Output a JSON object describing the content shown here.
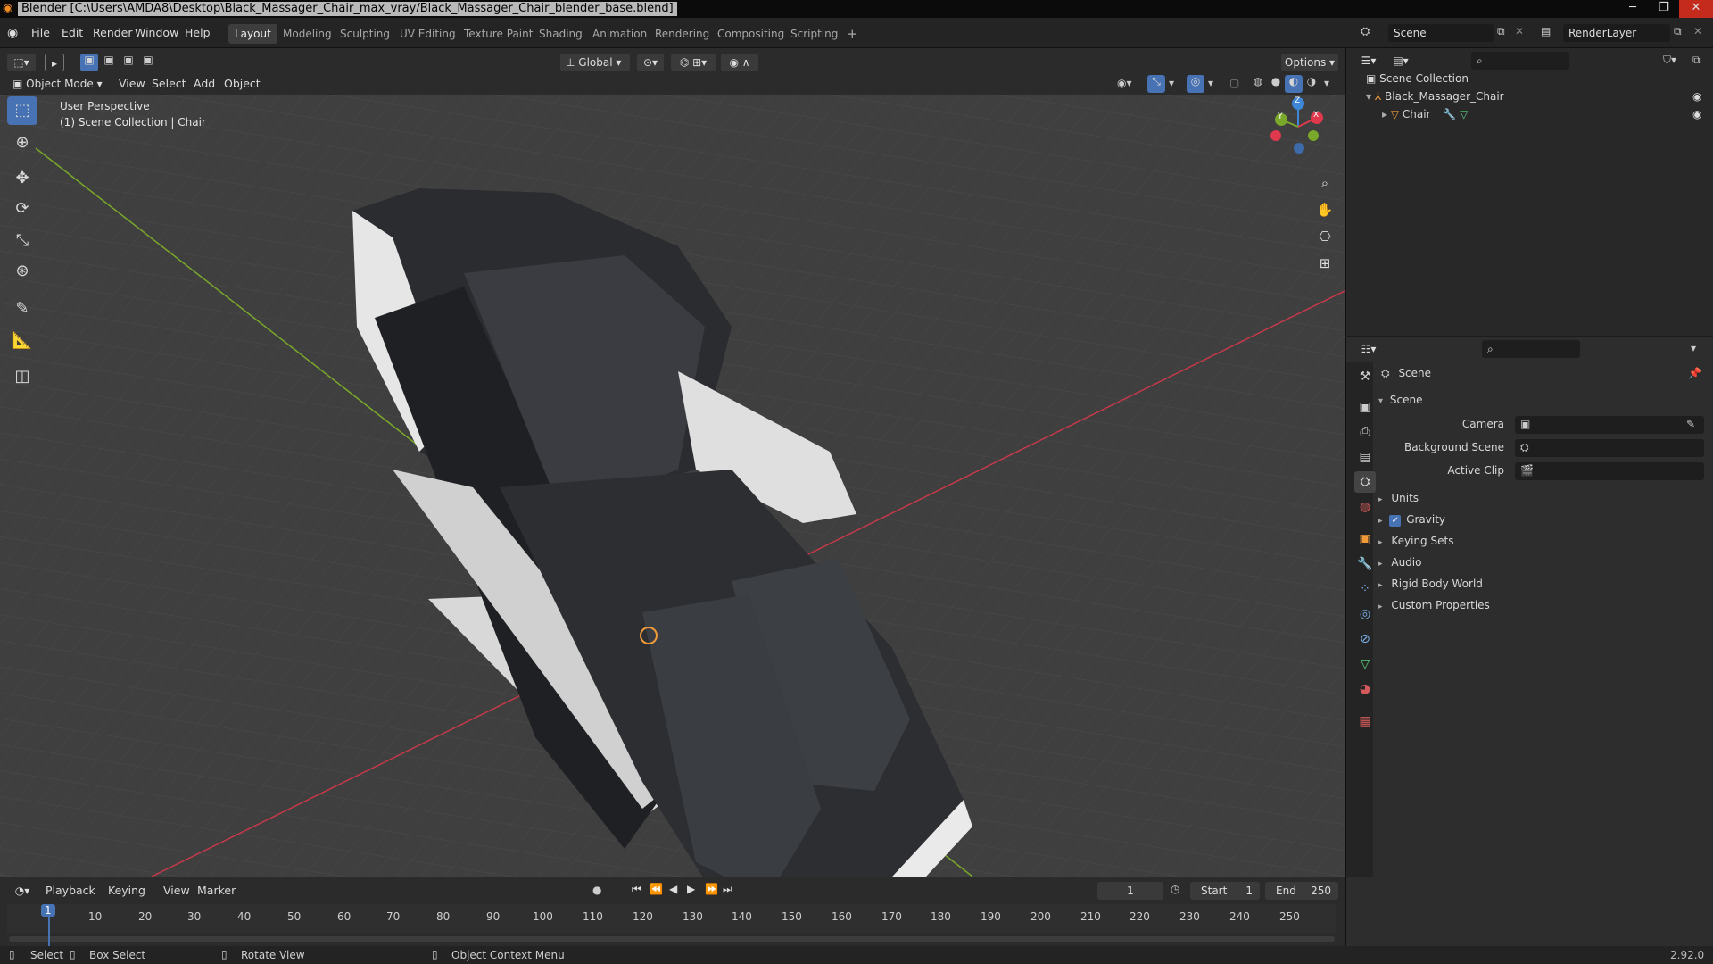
{
  "window": {
    "title": "Blender [C:\\Users\\AMDA8\\Desktop\\Black_Massager_Chair_max_vray/Black_Massager_Chair_blender_base.blend]",
    "controls": [
      "─",
      "❐",
      "✕"
    ]
  },
  "menubar": {
    "menus": [
      "File",
      "Edit",
      "Render",
      "Window",
      "Help"
    ],
    "workspaces": [
      "Layout",
      "Modeling",
      "Sculpting",
      "UV Editing",
      "Texture Paint",
      "Shading",
      "Animation",
      "Rendering",
      "Compositing",
      "Scripting"
    ],
    "active_workspace": "Layout",
    "add_workspace": "+",
    "scene_name": "Scene",
    "view_layer": "RenderLayer"
  },
  "viewport_header": {
    "transform_orientation": "Global",
    "options_label": "Options",
    "mode": "Object Mode",
    "menus": [
      "View",
      "Select",
      "Add",
      "Object"
    ]
  },
  "viewport": {
    "perspective": "User Perspective",
    "collection_info": "(1) Scene Collection | Chair",
    "gizmo_axes": [
      "X",
      "Y",
      "Z"
    ]
  },
  "outliner": {
    "root": "Scene Collection",
    "items": [
      {
        "label": "Black_Massager_Chair",
        "icon": "empty-axes-icon"
      },
      {
        "label": "Chair",
        "icon": "mesh-object-icon"
      }
    ]
  },
  "properties": {
    "context_title": "Scene",
    "panel_title": "Scene",
    "fields": [
      {
        "label": "Camera",
        "value": ""
      },
      {
        "label": "Background Scene",
        "value": ""
      },
      {
        "label": "Active Clip",
        "value": ""
      }
    ],
    "subpanels": [
      "Units",
      "Gravity",
      "Keying Sets",
      "Audio",
      "Rigid Body World",
      "Custom Properties"
    ],
    "gravity_enabled": true
  },
  "timeline": {
    "menus": [
      "Playback",
      "Keying",
      "View",
      "Marker"
    ],
    "current_frame": "1",
    "start_label": "Start",
    "start": "1",
    "end_label": "End",
    "end": "250",
    "ticks": [
      "1",
      "10",
      "20",
      "30",
      "40",
      "50",
      "60",
      "70",
      "80",
      "90",
      "100",
      "110",
      "120",
      "130",
      "140",
      "150",
      "160",
      "170",
      "180",
      "190",
      "200",
      "210",
      "220",
      "230",
      "240",
      "250"
    ]
  },
  "statusbar": {
    "select": "Select",
    "box_select": "Box Select",
    "rotate_view": "Rotate View",
    "context_menu": "Object Context Menu",
    "version": "2.92.0"
  },
  "colors": {
    "accent": "#4772b3",
    "x_axis": "#e0394d",
    "y_axis": "#7aa82b",
    "z_axis": "#3d86d8",
    "viewport_bg": "#3f3f3f"
  }
}
